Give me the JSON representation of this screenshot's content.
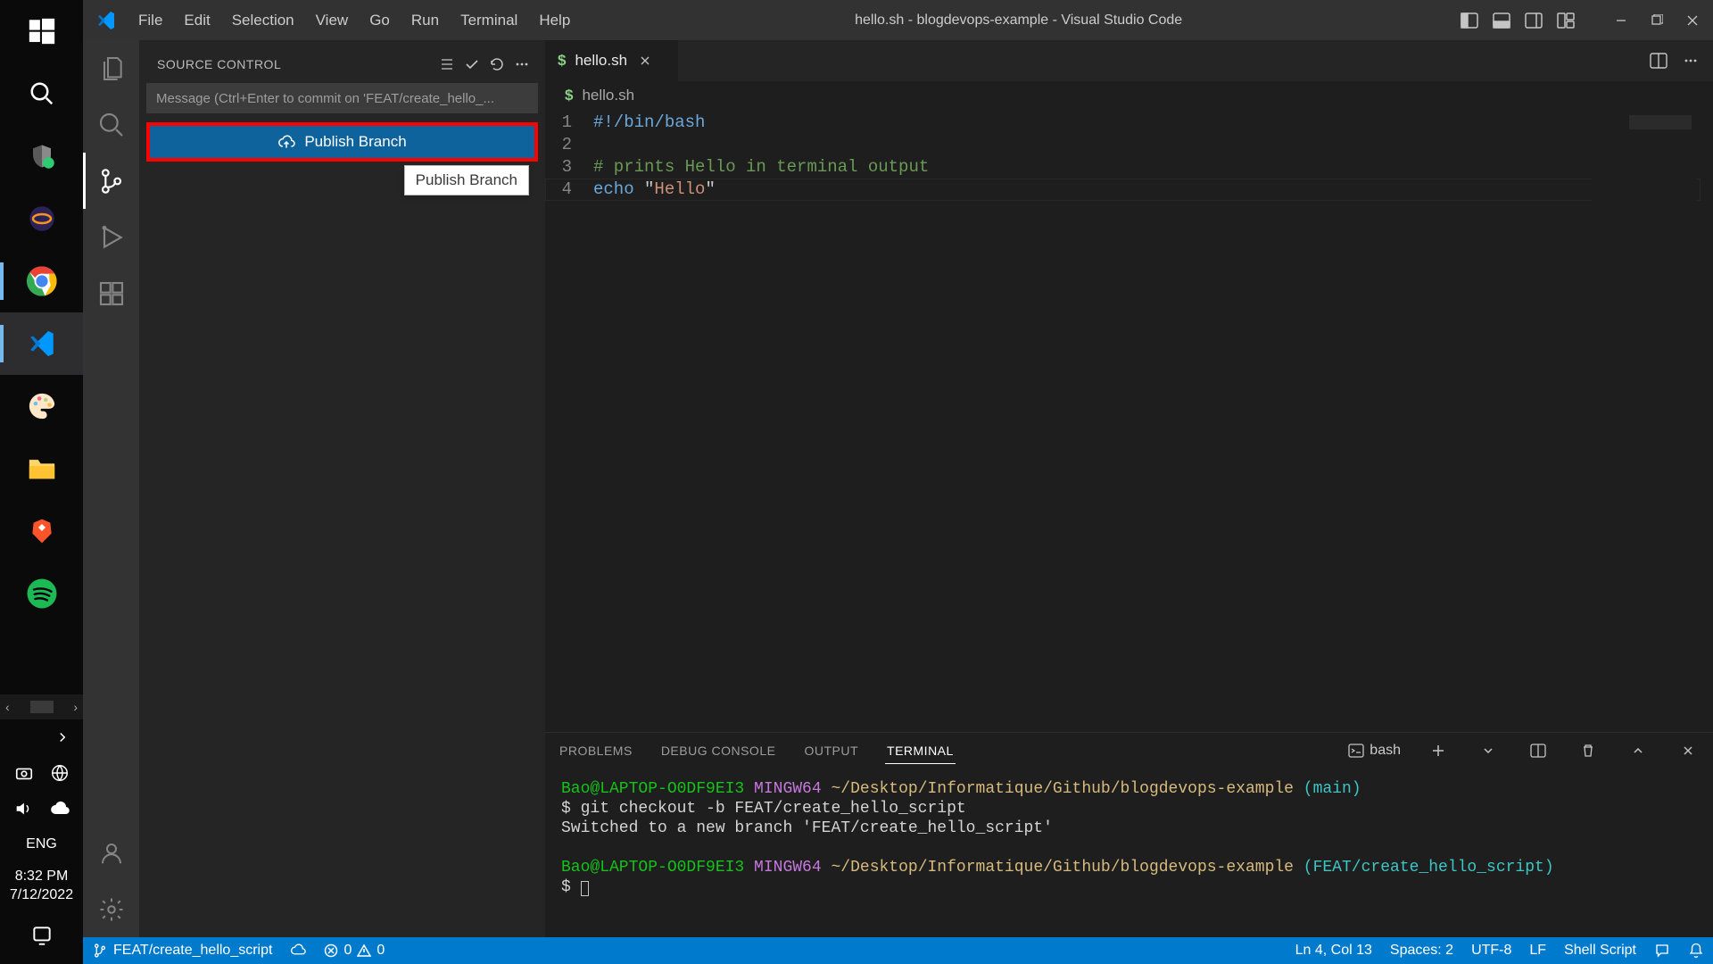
{
  "window": {
    "title": "hello.sh - blogdevops-example - Visual Studio Code"
  },
  "menu": [
    "File",
    "Edit",
    "Selection",
    "View",
    "Go",
    "Run",
    "Terminal",
    "Help"
  ],
  "activity": {
    "items": [
      "explorer",
      "search",
      "source-control",
      "run-debug",
      "extensions"
    ],
    "active": "source-control",
    "bottom": [
      "accounts",
      "settings"
    ]
  },
  "sidebar": {
    "title": "SOURCE CONTROL",
    "message_placeholder": "Message (Ctrl+Enter to commit on 'FEAT/create_hello_...",
    "publish_label": "Publish Branch",
    "tooltip": "Publish Branch"
  },
  "editor": {
    "tab": {
      "filename": "hello.sh",
      "icon": "$"
    },
    "breadcrumb": "hello.sh",
    "lines": [
      {
        "n": 1,
        "raw": "#!/bin/bash",
        "cls": "kw"
      },
      {
        "n": 2,
        "raw": "",
        "cls": ""
      },
      {
        "n": 3,
        "raw": "# prints Hello in terminal output",
        "cls": "cm"
      },
      {
        "n": 4,
        "echo": "echo",
        "q1": " \"",
        "str": "Hello",
        "q2": "\""
      }
    ],
    "cursor_line": 4
  },
  "panel": {
    "tabs": [
      "PROBLEMS",
      "DEBUG CONSOLE",
      "OUTPUT",
      "TERMINAL"
    ],
    "active": "TERMINAL",
    "shell": "bash",
    "lines": [
      {
        "prompt": {
          "user": "Bao@LAPTOP-O0DF9EI3",
          "env": "MINGW64",
          "path": "~/Desktop/Informatique/Github/blogdevops-example",
          "branch": "(main)"
        }
      },
      {
        "cmd": "$ git checkout -b FEAT/create_hello_script"
      },
      {
        "out": "Switched to a new branch 'FEAT/create_hello_script'"
      },
      {
        "blank": true
      },
      {
        "prompt": {
          "user": "Bao@LAPTOP-O0DF9EI3",
          "env": "MINGW64",
          "path": "~/Desktop/Informatique/Github/blogdevops-example",
          "branch": "(FEAT/create_hello_script)"
        }
      },
      {
        "cmd": "$ "
      }
    ]
  },
  "status": {
    "branch": "FEAT/create_hello_script",
    "errors": "0",
    "warnings": "0",
    "ln_col": "Ln 4, Col 13",
    "spaces": "Spaces: 2",
    "encoding": "UTF-8",
    "eol": "LF",
    "lang": "Shell Script"
  },
  "taskbar": {
    "lang": "ENG",
    "time": "8:32 PM",
    "date": "7/12/2022"
  }
}
